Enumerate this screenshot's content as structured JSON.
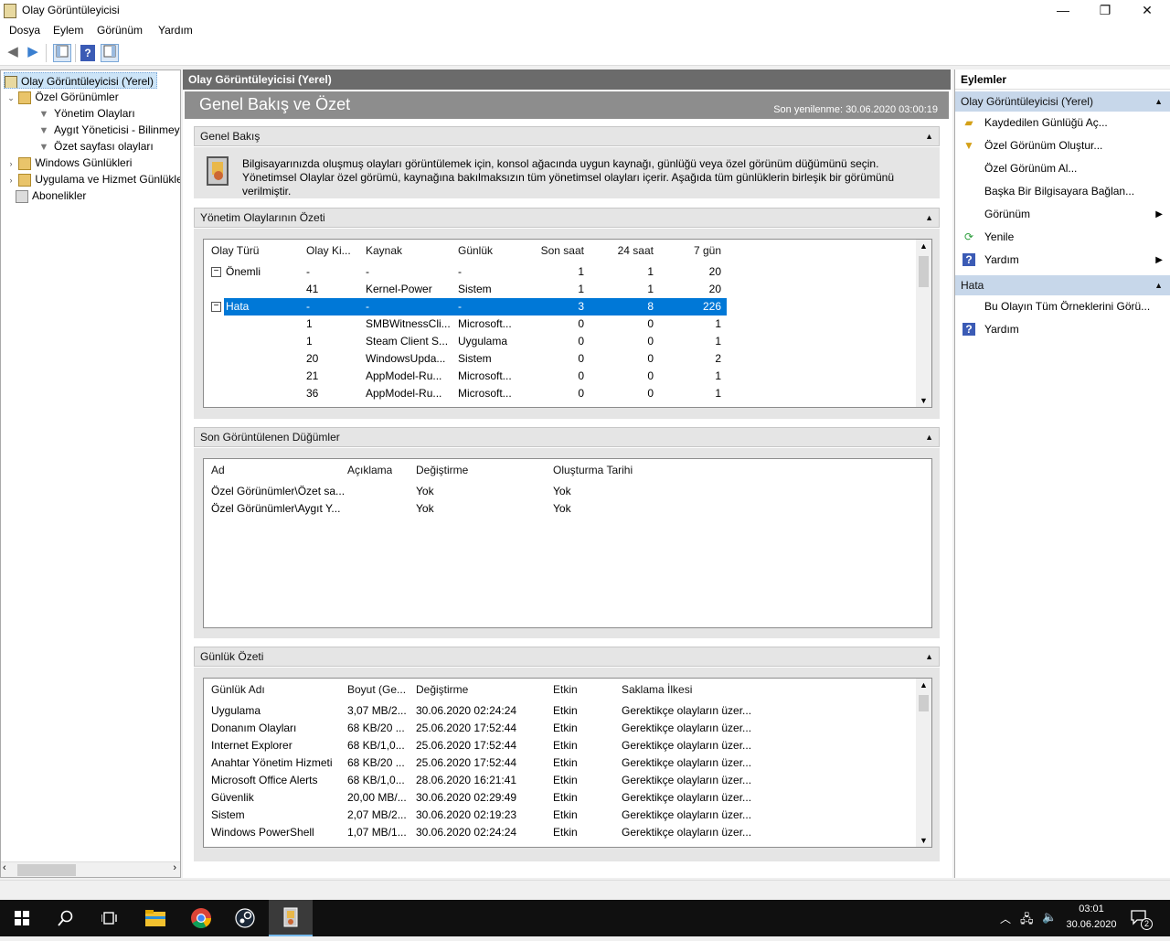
{
  "window": {
    "title": "Olay Görüntüleyicisi",
    "min": "—",
    "max": "❐",
    "close": "✕"
  },
  "menu": [
    "Dosya",
    "Eylem",
    "Görünüm",
    "Yardım"
  ],
  "tree": {
    "root": "Olay Görüntüleyicisi (Yerel)",
    "custom": "Özel Görünümler",
    "customChildren": [
      "Yönetim Olayları",
      "Aygıt Yöneticisi - Bilinmeyen",
      "Özet sayfası olayları"
    ],
    "windowsLogs": "Windows Günlükleri",
    "appLogs": "Uygulama ve Hizmet Günlükleri",
    "subscriptions": "Abonelikler"
  },
  "center": {
    "header": "Olay Görüntüleyicisi (Yerel)",
    "bigTitle": "Genel Bakış ve Özet",
    "refreshed": "Son yenilenme: 30.06.2020 03:00:19",
    "overview": {
      "title": "Genel Bakış",
      "text": "Bilgisayarınızda oluşmuş olayları görüntülemek için, konsol ağacında uygun kaynağı, günlüğü veya özel görünüm düğümünü seçin. Yönetimsel Olaylar özel görümü, kaynağına bakılmaksızın tüm yönetimsel olayları içerir. Aşağıda tüm günlüklerin birleşik bir görümünü verilmiştir."
    },
    "adminSummary": {
      "title": "Yönetim Olaylarının Özeti",
      "columns": [
        "Olay Türü",
        "Olay Ki...",
        "Kaynak",
        "Günlük",
        "Son saat",
        "24 saat",
        "7 gün"
      ],
      "rows": [
        [
          "Önemli",
          "-",
          "-",
          "-",
          "1",
          "1",
          "20"
        ],
        [
          "",
          "41",
          "Kernel-Power",
          "Sistem",
          "1",
          "1",
          "20"
        ],
        [
          "Hata",
          "-",
          "-",
          "-",
          "3",
          "8",
          "226"
        ],
        [
          "",
          "1",
          "SMBWitnessCli...",
          "Microsoft...",
          "0",
          "0",
          "1"
        ],
        [
          "",
          "1",
          "Steam Client S...",
          "Uygulama",
          "0",
          "0",
          "1"
        ],
        [
          "",
          "20",
          "WindowsUpda...",
          "Sistem",
          "0",
          "0",
          "2"
        ],
        [
          "",
          "21",
          "AppModel-Ru...",
          "Microsoft...",
          "0",
          "0",
          "1"
        ],
        [
          "",
          "36",
          "AppModel-Ru...",
          "Microsoft...",
          "0",
          "0",
          "1"
        ]
      ]
    },
    "recent": {
      "title": "Son Görüntülenen Düğümler",
      "columns": [
        "Ad",
        "Açıklama",
        "Değiştirme",
        "Oluşturma Tarihi"
      ],
      "rows": [
        [
          "Özel Görünümler\\Özet sa...",
          "",
          "Yok",
          "Yok"
        ],
        [
          "Özel Görünümler\\Aygıt Y...",
          "",
          "Yok",
          "Yok"
        ]
      ]
    },
    "logSummary": {
      "title": "Günlük Özeti",
      "columns": [
        "Günlük Adı",
        "Boyut (Ge...",
        "Değiştirme",
        "Etkin",
        "Saklama İlkesi"
      ],
      "rows": [
        [
          "Uygulama",
          "3,07 MB/2...",
          "30.06.2020 02:24:24",
          "Etkin",
          "Gerektikçe olayların üzer..."
        ],
        [
          "Donanım Olayları",
          "68 KB/20 ...",
          "25.06.2020 17:52:44",
          "Etkin",
          "Gerektikçe olayların üzer..."
        ],
        [
          "Internet Explorer",
          "68 KB/1,0...",
          "25.06.2020 17:52:44",
          "Etkin",
          "Gerektikçe olayların üzer..."
        ],
        [
          "Anahtar Yönetim Hizmeti",
          "68 KB/20 ...",
          "25.06.2020 17:52:44",
          "Etkin",
          "Gerektikçe olayların üzer..."
        ],
        [
          "Microsoft Office Alerts",
          "68 KB/1,0...",
          "28.06.2020 16:21:41",
          "Etkin",
          "Gerektikçe olayların üzer..."
        ],
        [
          "Güvenlik",
          "20,00 MB/...",
          "30.06.2020 02:29:49",
          "Etkin",
          "Gerektikçe olayların üzer..."
        ],
        [
          "Sistem",
          "2,07 MB/2...",
          "30.06.2020 02:19:23",
          "Etkin",
          "Gerektikçe olayların üzer..."
        ],
        [
          "Windows PowerShell",
          "1,07 MB/1...",
          "30.06.2020 02:24:24",
          "Etkin",
          "Gerektikçe olayların üzer..."
        ]
      ]
    }
  },
  "actions": {
    "title": "Eylemler",
    "group1": "Olay Görüntüleyicisi (Yerel)",
    "items1": [
      "Kaydedilen Günlüğü Aç...",
      "Özel Görünüm Oluştur...",
      "Özel Görünüm Al...",
      "Başka Bir Bilgisayara Bağlan...",
      "Görünüm",
      "Yenile",
      "Yardım"
    ],
    "group2": "Hata",
    "items2": [
      "Bu Olayın Tüm Örneklerini Görü...",
      "Yardım"
    ]
  },
  "taskbar": {
    "time": "03:01",
    "date": "30.06.2020",
    "notifications": "2"
  },
  "colors": {
    "selection": "#0078d7",
    "headerDark": "#6b6b6b",
    "actionGroup": "#c7d7ea"
  }
}
